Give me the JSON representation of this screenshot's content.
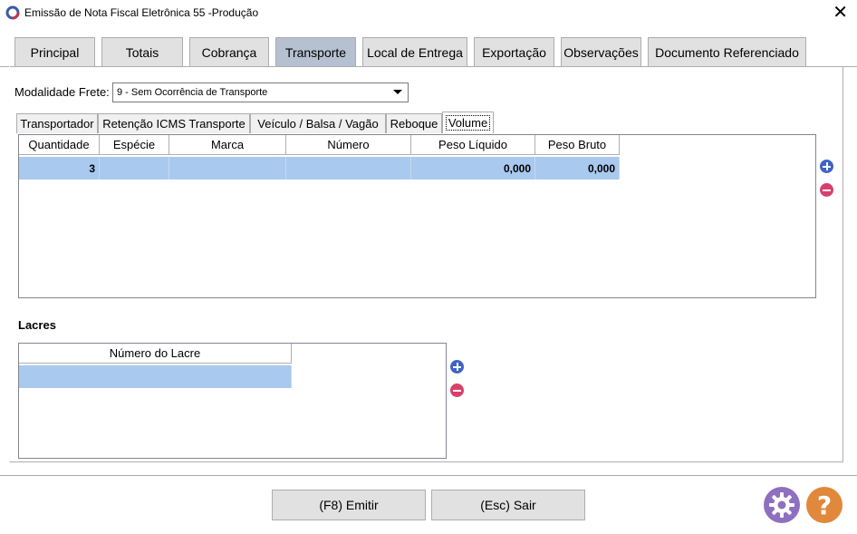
{
  "window": {
    "title": "Emissão de Nota Fiscal Eletrônica 55 -Produção",
    "close_glyph": "✕"
  },
  "main_tabs": [
    {
      "label": "Principal",
      "active": false
    },
    {
      "label": "Totais",
      "active": false
    },
    {
      "label": "Cobrança",
      "active": false
    },
    {
      "label": "Transporte",
      "active": true
    },
    {
      "label": "Local de Entrega",
      "active": false
    },
    {
      "label": "Exportação",
      "active": false
    },
    {
      "label": "Observações",
      "active": false
    },
    {
      "label": "Documento Referenciado",
      "active": false
    }
  ],
  "frete": {
    "label": "Modalidade Frete:",
    "value": "9 - Sem Ocorrência de Transporte"
  },
  "sub_tabs": [
    {
      "label": "Transportador",
      "active": false
    },
    {
      "label": "Retenção ICMS Transporte",
      "active": false
    },
    {
      "label": "Veículo / Balsa / Vagão",
      "active": false
    },
    {
      "label": "Reboque",
      "active": false
    },
    {
      "label": "Volume",
      "active": true
    }
  ],
  "volume_grid": {
    "headers": [
      "Quantidade",
      "Espécie",
      "Marca",
      "Número",
      "Peso Líquido",
      "Peso Bruto"
    ],
    "rows": [
      [
        "3",
        "",
        "",
        "",
        "0,000",
        "0,000"
      ]
    ]
  },
  "lacres": {
    "title": "Lacres",
    "headers": [
      "Número do Lacre"
    ],
    "rows": [
      [
        ""
      ]
    ]
  },
  "footer": {
    "emit_label": "(F8) Emitir",
    "exit_label": "(Esc) Sair",
    "help_glyph": "?"
  },
  "icons": {
    "add": "add-icon",
    "remove": "remove-icon",
    "settings": "gear-icon",
    "help": "question-icon"
  },
  "colors": {
    "active_tab": "#b5c0d0",
    "selected_row": "#a9c9ef",
    "add_icon": "#3f63c5",
    "remove_icon": "#d8406b",
    "settings_icon": "#8f6fbf",
    "help_icon": "#e0883b"
  }
}
